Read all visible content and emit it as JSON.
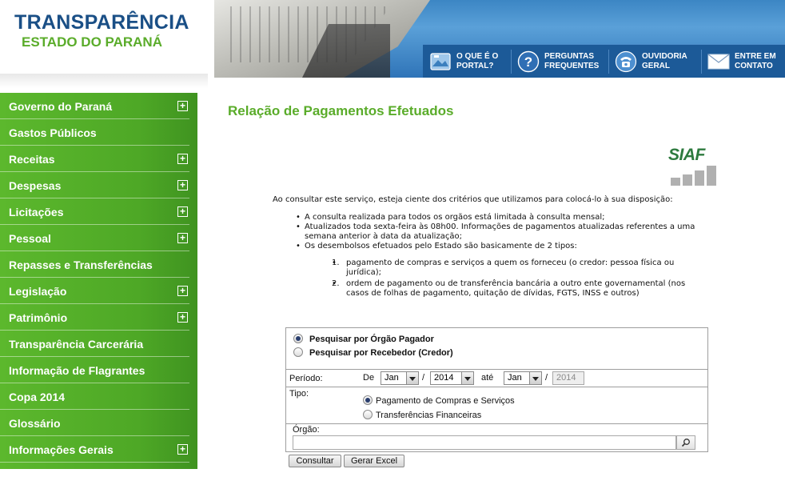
{
  "header": {
    "logo_title": "TRANSPARÊNCIA",
    "logo_subtitle": "ESTADO DO PARANÁ",
    "nav": [
      {
        "label": "O QUE É O PORTAL?",
        "icon": "portal-icon"
      },
      {
        "label": "PERGUNTAS FREQUENTES",
        "icon": "help-icon"
      },
      {
        "label": "OUVIDORIA GERAL",
        "icon": "phone-icon"
      },
      {
        "label": "ENTRE EM CONTATO",
        "icon": "envelope-icon"
      }
    ]
  },
  "sidebar": {
    "items": [
      {
        "label": "Governo do Paraná",
        "expandable": true
      },
      {
        "label": "Gastos Públicos",
        "expandable": false
      },
      {
        "label": "Receitas",
        "expandable": true
      },
      {
        "label": "Despesas",
        "expandable": true
      },
      {
        "label": "Licitações",
        "expandable": true
      },
      {
        "label": "Pessoal",
        "expandable": true
      },
      {
        "label": "Repasses e Transferências",
        "expandable": false
      },
      {
        "label": "Legislação",
        "expandable": true
      },
      {
        "label": "Patrimônio",
        "expandable": true
      },
      {
        "label": "Transparência Carcerária",
        "expandable": false
      },
      {
        "label": "Informação de Flagrantes",
        "expandable": false
      },
      {
        "label": "Copa 2014",
        "expandable": false
      },
      {
        "label": "Glossário",
        "expandable": false
      },
      {
        "label": "Informações Gerais",
        "expandable": true
      }
    ]
  },
  "main": {
    "title": "Relação de Pagamentos Efetuados",
    "siaf_logo": "SIAF",
    "intro": "Ao consultar este serviço, esteja ciente dos critérios que utilizamos para colocá-lo à sua disposição:",
    "bullets": [
      "A consulta realizada para todos os orgãos está limitada à consulta mensal;",
      "Atualizados toda sexta-feira às 08h00. Informações de pagamentos atualizadas referentes a uma semana anterior à data da atualização;",
      "Os desembolsos efetuados pelo Estado são basicamente de 2 tipos:"
    ],
    "types": [
      {
        "num": "1.",
        "text": "pagamento de compras e serviços a quem os forneceu (o credor: pessoa física ou  jurídica);"
      },
      {
        "num": "2.",
        "text": "ordem de pagamento ou de transferência bancária a outro ente governamental (nos casos de folhas de pagamento, quitação de dívidas, FGTS, INSS e outros)"
      }
    ]
  },
  "form": {
    "search_by_orgao": "Pesquisar por Órgão Pagador",
    "search_by_recebedor": "Pesquisar por Recebedor (Credor)",
    "periodo_label": "Período:",
    "de_label": "De",
    "ate_label": "até",
    "slash": "/",
    "month_from": "Jan",
    "year_from": "2014",
    "month_to": "Jan",
    "year_to": "2014",
    "tipo_label": "Tipo:",
    "tipo_compras": "Pagamento de Compras e Serviços",
    "tipo_transferencias": "Transferências Financeiras",
    "orgao_label": "Órgão:",
    "orgao_value": "",
    "consultar_label": "Consultar",
    "excel_label": "Gerar Excel"
  },
  "colors": {
    "brand_blue": "#1a4f86",
    "brand_green": "#5aac2a",
    "sidebar_green": "#4ea826",
    "nav_blue": "#1c5a98"
  }
}
